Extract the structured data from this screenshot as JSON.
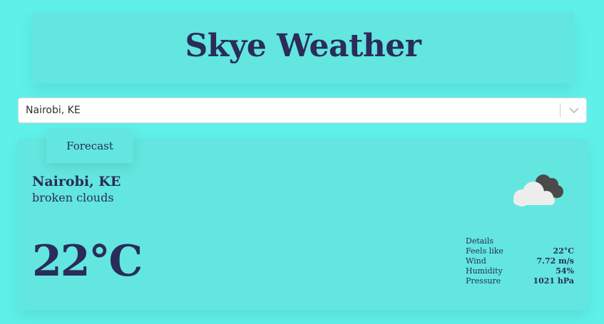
{
  "app": {
    "title": "Skye Weather"
  },
  "search": {
    "selected_value": "Nairobi, KE"
  },
  "tab": {
    "label": "Forecast"
  },
  "current": {
    "city": "Nairobi, KE",
    "description": "broken clouds",
    "temperature": "22°C",
    "icon": "broken-clouds-icon"
  },
  "details": {
    "title": "Details",
    "rows": [
      {
        "label": "Feels like",
        "value": "22°C"
      },
      {
        "label": "Wind",
        "value": "7.72 m/s"
      },
      {
        "label": "Humidity",
        "value": "54%"
      },
      {
        "label": "Pressure",
        "value": "1021 hPa"
      }
    ]
  },
  "colors": {
    "background": "#5ff0ea",
    "panel": "#62e6df",
    "text": "#2a2c5a"
  }
}
